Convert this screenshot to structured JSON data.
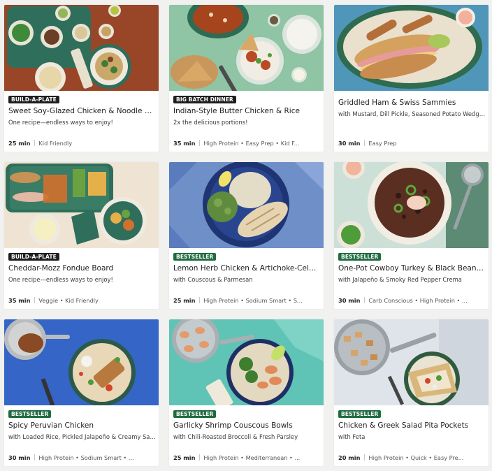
{
  "cards": [
    {
      "tag": "BUILD-A-PLATE",
      "tag_style": "dark",
      "title": "Sweet Soy-Glazed Chicken & Noodle Bar",
      "subtitle": "One recipe—endless ways to enjoy!",
      "time": "25 min",
      "tags": "Kid Friendly"
    },
    {
      "tag": "BIG BATCH DINNER",
      "tag_style": "dark",
      "title": "Indian-Style Butter Chicken & Rice",
      "subtitle": "2x the delicious portions!",
      "time": "35 min",
      "tags": "High Protein • Easy Prep • Kid F..."
    },
    {
      "tag": "",
      "tag_style": "",
      "title": "Griddled Ham & Swiss Sammies",
      "subtitle": "with Mustard, Dill Pickle, Seasoned Potato Wedges ...",
      "time": "30 min",
      "tags": "Easy Prep"
    },
    {
      "tag": "BUILD-A-PLATE",
      "tag_style": "dark",
      "title": "Cheddar-Mozz Fondue Board",
      "subtitle": "One recipe—endless ways to enjoy!",
      "time": "35 min",
      "tags": "Veggie • Kid Friendly"
    },
    {
      "tag": "BESTSELLER",
      "tag_style": "green",
      "title": "Lemon Herb Chicken & Artichoke-Celery...",
      "subtitle": "with Couscous & Parmesan",
      "time": "25 min",
      "tags": "High Protein • Sodium Smart • S..."
    },
    {
      "tag": "BESTSELLER",
      "tag_style": "green",
      "title": "One-Pot Cowboy Turkey & Black Bean C...",
      "subtitle": "with Jalapeño & Smoky Red Pepper Crema",
      "time": "30 min",
      "tags": "Carb Conscious • High Protein • ..."
    },
    {
      "tag": "BESTSELLER",
      "tag_style": "green",
      "title": "Spicy Peruvian Chicken",
      "subtitle": "with Loaded Rice, Pickled Jalapeño & Creamy Salsa...",
      "time": "30 min",
      "tags": "High Protein • Sodium Smart • ..."
    },
    {
      "tag": "BESTSELLER",
      "tag_style": "green",
      "title": "Garlicky Shrimp Couscous Bowls",
      "subtitle": "with Chili-Roasted Broccoli & Fresh Parsley",
      "time": "25 min",
      "tags": "High Protein • Mediterranean • ..."
    },
    {
      "tag": "BESTSELLER",
      "tag_style": "green",
      "title": "Chicken & Greek Salad Pita Pockets",
      "subtitle": "with Feta",
      "time": "20 min",
      "tags": "High Protein • Quick • Easy Pre..."
    }
  ],
  "colors": {
    "tag_dark": "#1f1f1f",
    "tag_green": "#1f6b3f",
    "page_bg": "#f1f1ef"
  }
}
